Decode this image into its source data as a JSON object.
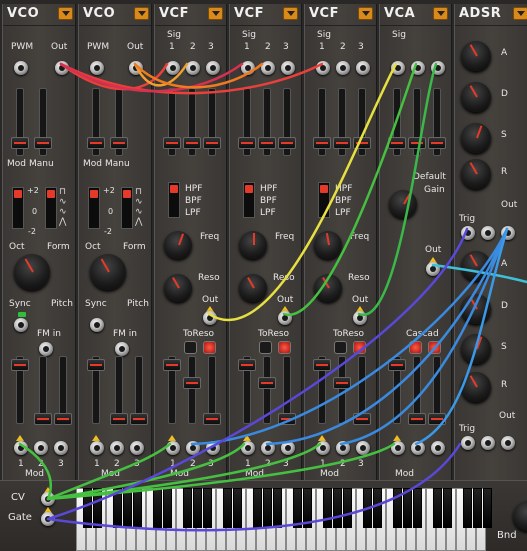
{
  "modules": [
    {
      "title": "VCO"
    },
    {
      "title": "VCO"
    },
    {
      "title": "VCF"
    },
    {
      "title": "VCF"
    },
    {
      "title": "VCF"
    },
    {
      "title": "VCA"
    },
    {
      "title": "ADSR"
    }
  ],
  "vco": {
    "pwm": "PWM",
    "out": "Out",
    "mod": "Mod",
    "manu": "Manu",
    "plus2": "+2",
    "zero": "0",
    "minus2": "-2",
    "oct": "Oct",
    "form": "Form",
    "sync": "Sync",
    "pitch": "Pitch",
    "fm_in": "FM in",
    "mod_label": "Mod",
    "n1": "1",
    "n2": "2",
    "n3": "3"
  },
  "vcf": {
    "sig": "Sig",
    "n1": "1",
    "n2": "2",
    "n3": "3",
    "hpf": "HPF",
    "bpf": "BPF",
    "lpf": "LPF",
    "freq": "Freq",
    "reso": "Reso",
    "out": "Out",
    "toreso": "ToReso",
    "mod": "Mod"
  },
  "vca": {
    "sig": "Sig",
    "default": "Default",
    "gain": "Gain",
    "out": "Out",
    "cascad": "Cascad",
    "mod": "Mod"
  },
  "adsr": {
    "a": "A",
    "d": "D",
    "s": "S",
    "r": "R",
    "trig": "Trig",
    "out": "Out"
  },
  "keyboard": {
    "cv": "CV",
    "gate": "Gate",
    "bnd": "Bnd"
  },
  "colors": {
    "accent": "#d98a1a",
    "cable_red": "#e8403a",
    "cable_orange": "#f0a030",
    "cable_yellow": "#e6e040",
    "cable_green": "#46c040",
    "cable_blue": "#3a8ae0",
    "cable_cyan": "#40c0d8",
    "cable_violet": "#5a48d8"
  }
}
